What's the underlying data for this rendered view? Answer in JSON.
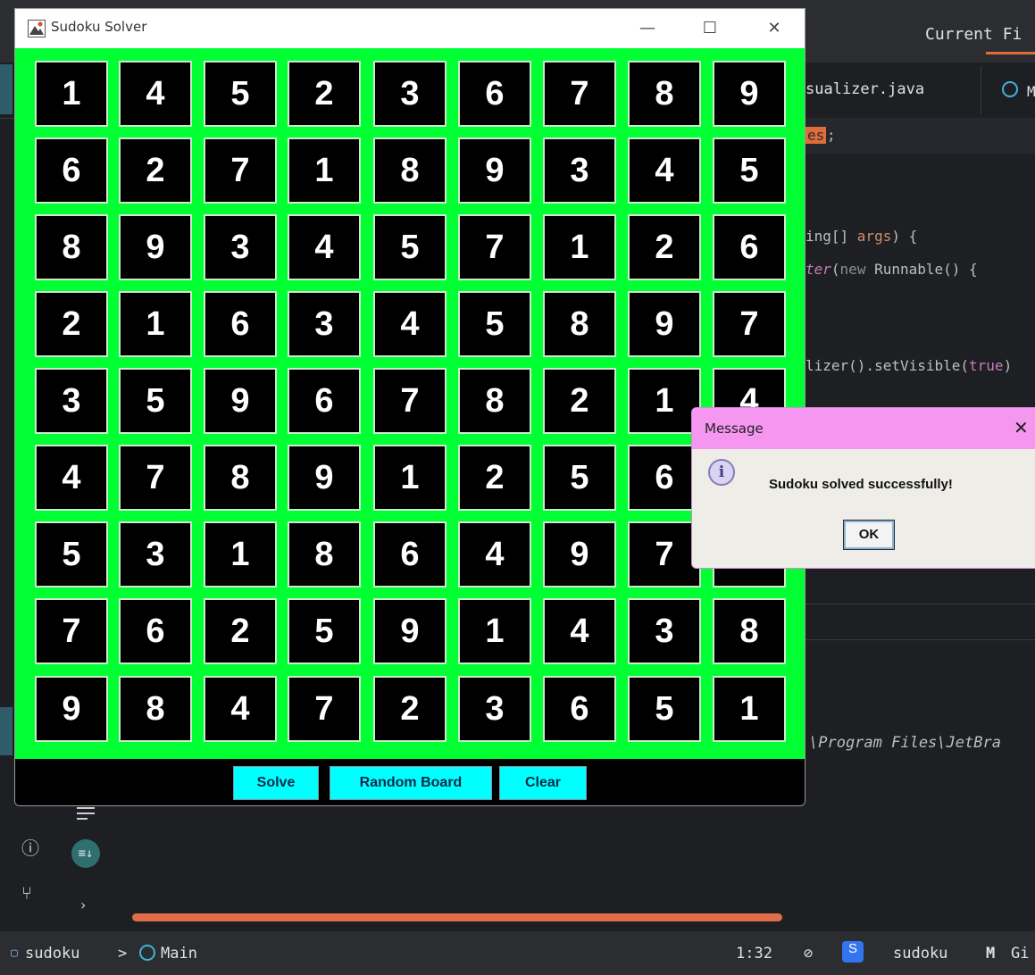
{
  "window": {
    "title": "Sudoku Solver",
    "minimize_glyph": "—",
    "maximize_glyph": "☐",
    "close_glyph": "✕"
  },
  "board": [
    [
      "1",
      "4",
      "5",
      "2",
      "3",
      "6",
      "7",
      "8",
      "9"
    ],
    [
      "6",
      "2",
      "7",
      "1",
      "8",
      "9",
      "3",
      "4",
      "5"
    ],
    [
      "8",
      "9",
      "3",
      "4",
      "5",
      "7",
      "1",
      "2",
      "6"
    ],
    [
      "2",
      "1",
      "6",
      "3",
      "4",
      "5",
      "8",
      "9",
      "7"
    ],
    [
      "3",
      "5",
      "9",
      "6",
      "7",
      "8",
      "2",
      "1",
      "4"
    ],
    [
      "4",
      "7",
      "8",
      "9",
      "1",
      "2",
      "5",
      "6",
      ""
    ],
    [
      "5",
      "3",
      "1",
      "8",
      "6",
      "4",
      "9",
      "7",
      ""
    ],
    [
      "7",
      "6",
      "2",
      "5",
      "9",
      "1",
      "4",
      "3",
      "8"
    ],
    [
      "9",
      "8",
      "4",
      "7",
      "2",
      "3",
      "6",
      "5",
      "1"
    ]
  ],
  "buttons": {
    "solve": "Solve",
    "random": "Random Board",
    "clear": "Clear"
  },
  "dialog": {
    "title": "Message",
    "close_glyph": "✕",
    "icon_glyph": "i",
    "message": "Sudoku solved successfully!",
    "ok": "OK"
  },
  "ide": {
    "top_label": "Current Fi",
    "tab_file": "sualizer.java",
    "tab_next": "M",
    "code_es": "es",
    "code_semicolon": ";",
    "code_line1_a": "ing[] ",
    "code_line1_b": "args",
    "code_line1_c": ") {",
    "code_line2_a": "ter",
    "code_line2_b": "(",
    "code_line2_c": "new",
    "code_line2_d": " Runnable() {",
    "code_line3_a": "lizer().setVisible(",
    "code_line3_b": "true",
    "code_line3_c": ")",
    "console": "\\Program Files\\JetBra",
    "problems_glyph": "ⓘ",
    "vcs_glyph": "⑂",
    "chevron_glyph": "›",
    "scroll_glyph": "≡↓"
  },
  "statusbar": {
    "project": "sudoku",
    "separator": ">",
    "module": "Main",
    "position": "1:32",
    "no_access_glyph": "⊘",
    "service_letter": "S",
    "service_name": "sudoku",
    "vcs_glyph": "M",
    "vcs_label": "Gi"
  },
  "colors": {
    "board_bg": "#00ff33",
    "button_bg": "#00ffff",
    "dialog_title_bg": "#f596f0",
    "accent_orange": "#e06c3c"
  }
}
